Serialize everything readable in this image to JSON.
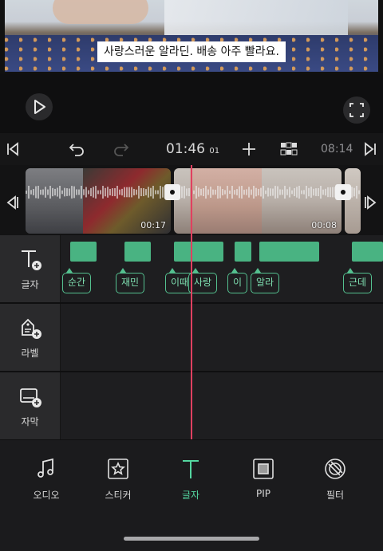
{
  "preview": {
    "subtitle": "사랑스러운 알라딘. 배송 아주 빨라요."
  },
  "toolbar": {
    "current_time": "01:46",
    "current_frame": "01",
    "total_time": "08:14"
  },
  "timeline": {
    "clips": [
      {
        "duration": "00:17"
      },
      {
        "duration": "00:08"
      }
    ]
  },
  "tracks": [
    {
      "label": "글자",
      "icon": "text-add-icon"
    },
    {
      "label": "라벨",
      "icon": "label-add-icon"
    },
    {
      "label": "자막",
      "icon": "subtitle-add-icon"
    }
  ],
  "text_track": {
    "chips": [
      "순간",
      "재민",
      "이때",
      "사랑",
      "이",
      "알라",
      "근데"
    ]
  },
  "bottom_nav": [
    {
      "label": "오디오",
      "icon": "music-note-icon"
    },
    {
      "label": "스티커",
      "icon": "sticker-icon"
    },
    {
      "label": "글자",
      "icon": "text-icon"
    },
    {
      "label": "PIP",
      "icon": "pip-icon"
    },
    {
      "label": "필터",
      "icon": "filter-icon"
    }
  ],
  "colors": {
    "accent": "#54d6a0",
    "text_segment": "#49b382",
    "playhead": "#e04060"
  }
}
